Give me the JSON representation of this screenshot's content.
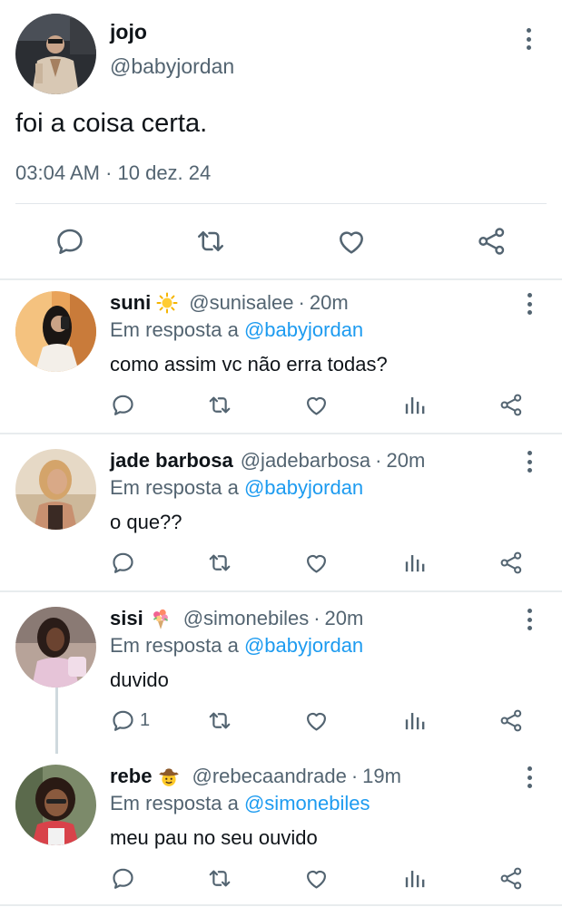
{
  "main_tweet": {
    "name": "jojo",
    "handle": "@babyjordan",
    "text": "foi a coisa certa.",
    "timestamp": "03:04 AM · 10 dez. 24",
    "actions": [
      "reply-icon",
      "retweet-icon",
      "like-icon",
      "share-icon"
    ]
  },
  "replies": [
    {
      "name": "suni",
      "emoji": "sun",
      "handle": "@sunisalee",
      "time": "20m",
      "in_reply_prefix": "Em resposta a",
      "in_reply_to": "@babyjordan",
      "text": "como assim vc não erra todas?",
      "reply_count": ""
    },
    {
      "name": "jade barbosa",
      "emoji": "",
      "handle": "@jadebarbosa",
      "time": "20m",
      "in_reply_prefix": "Em resposta a",
      "in_reply_to": "@babyjordan",
      "text": "o que??",
      "reply_count": ""
    },
    {
      "name": "sisi",
      "emoji": "bouquet",
      "handle": "@simonebiles",
      "time": "20m",
      "in_reply_prefix": "Em resposta a",
      "in_reply_to": "@babyjordan",
      "text": "duvido",
      "reply_count": "1"
    },
    {
      "name": "rebe",
      "emoji": "cowboy",
      "handle": "@rebecaandrade",
      "time": "19m",
      "in_reply_prefix": "Em resposta a",
      "in_reply_to": "@simonebiles",
      "text": "meu pau no seu ouvido",
      "reply_count": ""
    }
  ],
  "separator": "·",
  "colors": {
    "text": "#0f1419",
    "secondary": "#536471",
    "link": "#1d9bf0",
    "divider": "#e1e6ea"
  }
}
